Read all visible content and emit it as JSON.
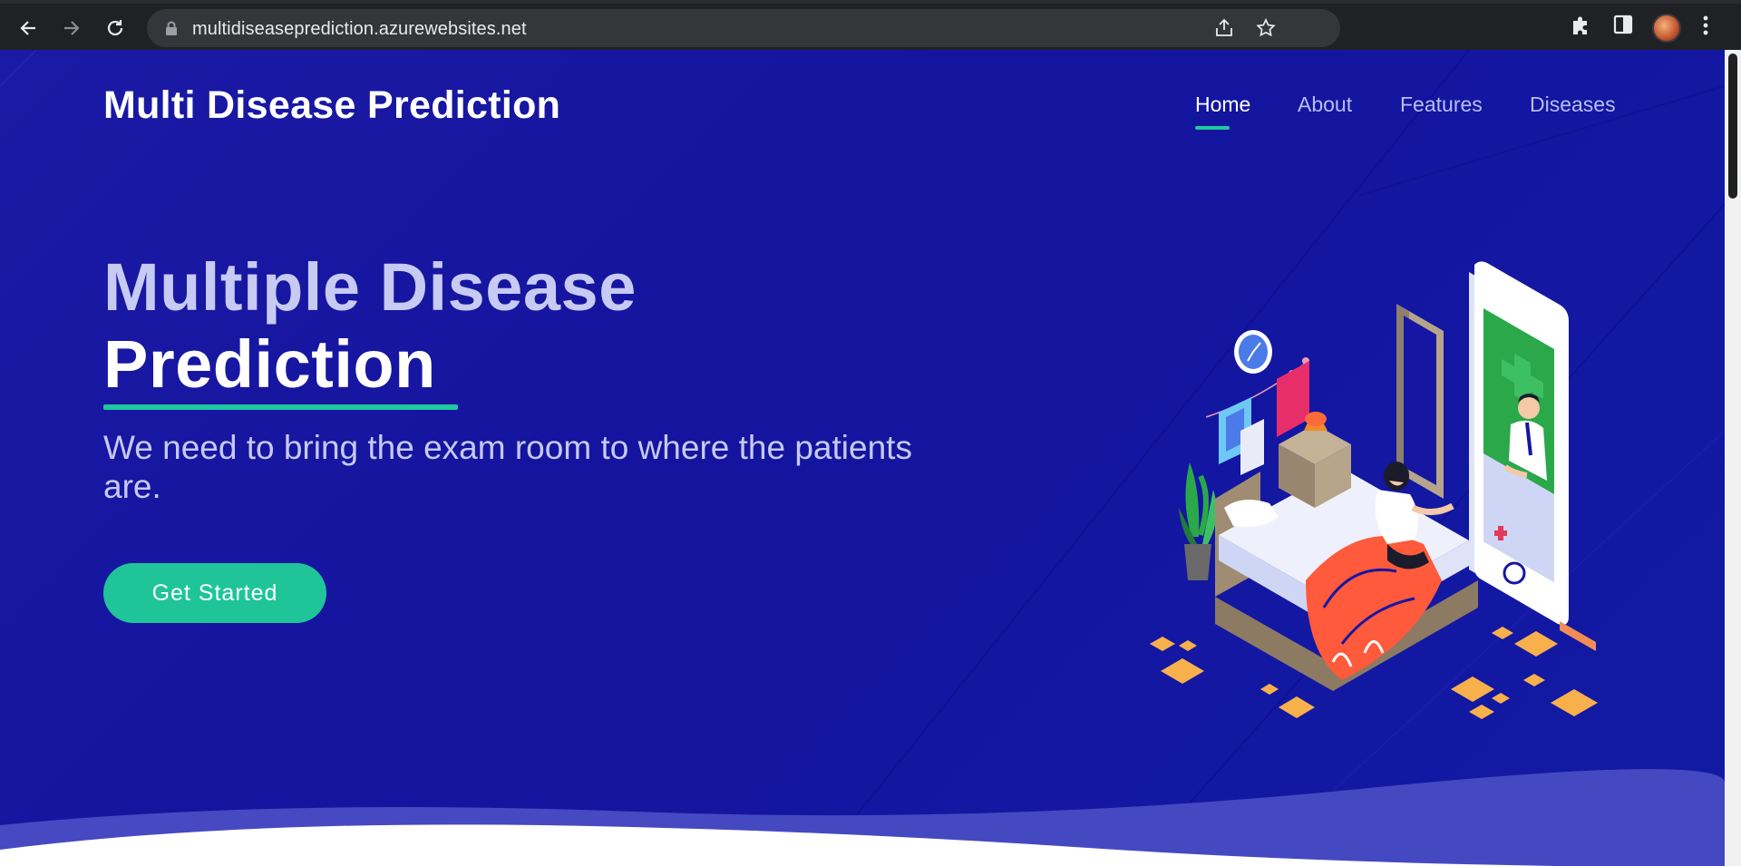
{
  "browser": {
    "url": "multidiseaseprediction.azurewebsites.net",
    "icons": [
      "back-icon",
      "forward-icon",
      "reload-icon",
      "lock-icon",
      "share-icon",
      "star-icon",
      "extensions-icon",
      "sidepanel-icon",
      "profile-avatar",
      "menu-icon"
    ]
  },
  "site": {
    "logo": "Multi Disease Prediction",
    "nav": [
      {
        "label": "Home",
        "active": true
      },
      {
        "label": "About",
        "active": false
      },
      {
        "label": "Features",
        "active": false
      },
      {
        "label": "Diseases",
        "active": false
      }
    ]
  },
  "hero": {
    "title_line1": "Multiple Disease",
    "title_line2": "Prediction",
    "subtitle": "We need to bring the exam room to where the patients are.",
    "cta_label": "Get Started"
  },
  "colors": {
    "hero_bg": "#1616a2",
    "accent": "#1ec9a0",
    "nav_inactive": "#b8bdf0"
  }
}
